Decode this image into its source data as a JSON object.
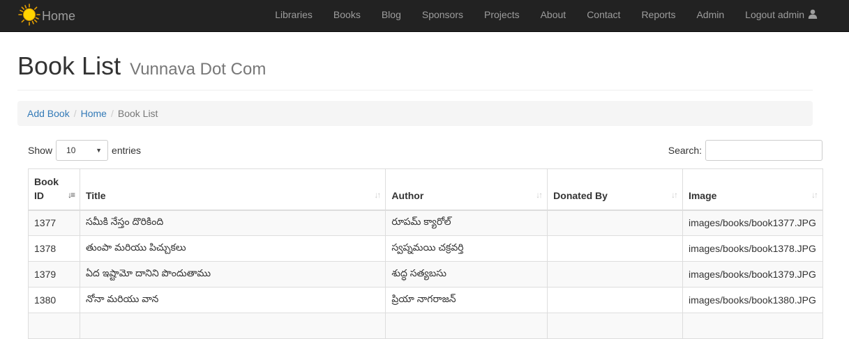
{
  "navbar": {
    "brand_label": "Home",
    "links": [
      {
        "label": "Libraries",
        "name": "nav-libraries"
      },
      {
        "label": "Books",
        "name": "nav-books"
      },
      {
        "label": "Blog",
        "name": "nav-blog"
      },
      {
        "label": "Sponsors",
        "name": "nav-sponsors"
      },
      {
        "label": "Projects",
        "name": "nav-projects"
      },
      {
        "label": "About",
        "name": "nav-about"
      },
      {
        "label": "Contact",
        "name": "nav-contact"
      },
      {
        "label": "Reports",
        "name": "nav-reports"
      },
      {
        "label": "Admin",
        "name": "nav-admin"
      }
    ],
    "logout_label": "Logout admin",
    "logout_icon": "user-icon",
    "brand_icon": "sun-logo-icon",
    "bg_color": "#222222"
  },
  "header": {
    "title": "Book List",
    "subtitle": "Vunnava Dot Com"
  },
  "breadcrumb": {
    "items": [
      "Add Book",
      "Home"
    ],
    "active": "Book List"
  },
  "controls": {
    "show_label": "Show",
    "entries_value": "10",
    "entries_label": "entries",
    "search_label": "Search:",
    "search_value": ""
  },
  "table": {
    "columns": [
      "Book ID",
      "Title",
      "Author",
      "Donated By",
      "Image"
    ],
    "sorted_column": "Book ID",
    "rows": [
      {
        "id": "1377",
        "title": "సమీకి నేస్తం దొరికింది",
        "author": "రూపమ్ క్యారోల్",
        "donated_by": "",
        "image": "images/books/book1377.JPG"
      },
      {
        "id": "1378",
        "title": "తుంపా మరియు పిచ్చుకలు",
        "author": "స్వప్నమయి చక్రవర్తి",
        "donated_by": "",
        "image": "images/books/book1378.JPG"
      },
      {
        "id": "1379",
        "title": "ఏద ఇష్టామో దానిని పొందుతాము",
        "author": "శుద్ధ సత్యబసు",
        "donated_by": "",
        "image": "images/books/book1379.JPG"
      },
      {
        "id": "1380",
        "title": "నోనా మరియు వాన",
        "author": "ప్రియా నాగరాజన్",
        "donated_by": "",
        "image": "images/books/book1380.JPG"
      },
      {
        "id": "",
        "title": "",
        "author": "",
        "donated_by": "",
        "image": ""
      }
    ]
  },
  "colors": {
    "link": "#337ab7",
    "nav_text": "#9d9d9d",
    "breadcrumb_bg": "#f5f5f5",
    "striped_row": "#f9f9f9"
  }
}
